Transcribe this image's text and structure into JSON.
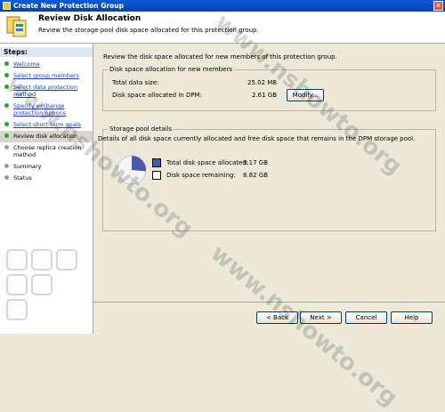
{
  "window": {
    "title": "Create New Protection Group",
    "close_glyph": "✕"
  },
  "header": {
    "title": "Review Disk Allocation",
    "subtitle": "Review the storage pool disk space allocated for this protection group."
  },
  "sidebar": {
    "steps_label": "Steps:",
    "steps": [
      {
        "label": "Welcome",
        "state": "done"
      },
      {
        "label": "Select group members",
        "state": "done"
      },
      {
        "label": "Select data protection method",
        "state": "done"
      },
      {
        "label": "Specify exchange protection options",
        "state": "done"
      },
      {
        "label": "Select short-term goals",
        "state": "done"
      },
      {
        "label": "Review disk allocation",
        "state": "active"
      },
      {
        "label": "Choose replica creation method",
        "state": "pending"
      },
      {
        "label": "Summary",
        "state": "pending"
      },
      {
        "label": "Status",
        "state": "pending"
      }
    ]
  },
  "main": {
    "intro": "Review the disk space allocated for new members of this protection group.",
    "allocation": {
      "legend": "Disk space allocation for new members",
      "total_label": "Total data size:",
      "total_value": "25.02 MB",
      "dpm_label": "Disk space allocated in DPM:",
      "dpm_value": "2.61 GB",
      "modify_label": "Modify..."
    },
    "pool": {
      "legend": "Storage pool details",
      "description": "Details of all disk space currently allocated and free disk space that remains in the DPM storage pool.",
      "allocated_label": "Total disk space allocated:",
      "allocated_value": "3.17 GB",
      "remaining_label": "Disk space remaining:",
      "remaining_value": "8.82 GB",
      "allocated_color": "#4a5aa8",
      "remaining_color": "#ffffff"
    }
  },
  "footer": {
    "back": "< Back",
    "next": "Next >",
    "cancel": "Cancel",
    "help": "Help"
  },
  "watermark": {
    "text": "www.nshowto.org"
  }
}
